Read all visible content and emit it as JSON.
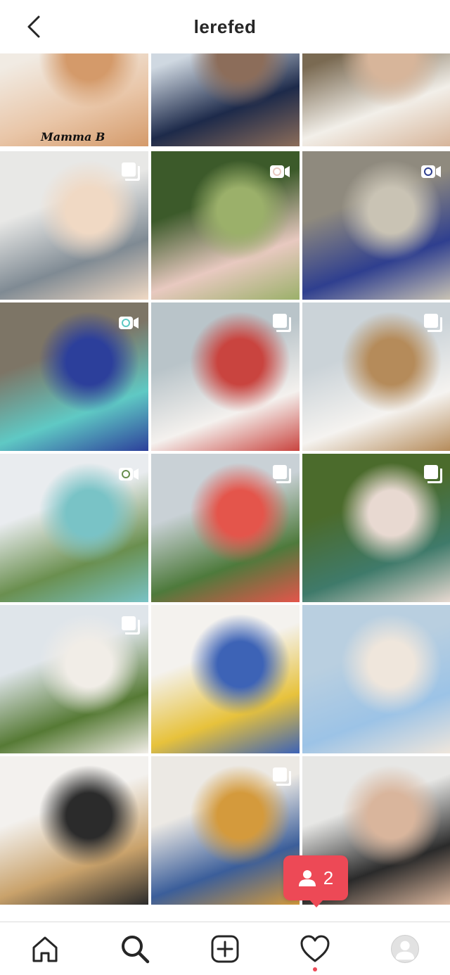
{
  "header": {
    "username": "lerefed",
    "back_icon": "chevron-left-icon"
  },
  "grid": {
    "tiles": [
      {
        "row": 0,
        "col": 0,
        "kind": "photo",
        "badge": null,
        "caption_overlay": "Mamma B",
        "palette": [
          "#f1ebe3",
          "#e9c6a8",
          "#d49a6a"
        ]
      },
      {
        "row": 0,
        "col": 1,
        "kind": "photo",
        "badge": null,
        "palette": [
          "#cfd8e1",
          "#1d2a4a",
          "#8c6d5a"
        ]
      },
      {
        "row": 0,
        "col": 2,
        "kind": "photo",
        "badge": null,
        "palette": [
          "#7a6a52",
          "#f2efe9",
          "#d7b59a"
        ]
      },
      {
        "row": 1,
        "col": 0,
        "kind": "photo",
        "badge": "carousel",
        "palette": [
          "#e8e8e6",
          "#7f8a93",
          "#f0d9c4"
        ]
      },
      {
        "row": 1,
        "col": 1,
        "kind": "video",
        "badge": "video",
        "palette": [
          "#3c5a2a",
          "#e8c9c0",
          "#9bb06a"
        ]
      },
      {
        "row": 1,
        "col": 2,
        "kind": "video",
        "badge": "video",
        "palette": [
          "#8f8a7e",
          "#2f3f8f",
          "#c9c3b4"
        ]
      },
      {
        "row": 2,
        "col": 0,
        "kind": "video",
        "badge": "video",
        "palette": [
          "#7d7566",
          "#5fc9c4",
          "#2c3f9b"
        ]
      },
      {
        "row": 2,
        "col": 1,
        "kind": "photo",
        "badge": "carousel",
        "palette": [
          "#b9c4c9",
          "#f4f1ee",
          "#c9443f"
        ]
      },
      {
        "row": 2,
        "col": 2,
        "kind": "photo",
        "badge": "carousel",
        "palette": [
          "#cbd3d8",
          "#f5f3f0",
          "#b58b5a"
        ]
      },
      {
        "row": 3,
        "col": 0,
        "kind": "video",
        "badge": "video",
        "palette": [
          "#e9ecef",
          "#6a8f4f",
          "#79c3c6"
        ]
      },
      {
        "row": 3,
        "col": 1,
        "kind": "photo",
        "badge": "carousel",
        "palette": [
          "#c9d1d6",
          "#4e7a3c",
          "#e4554b"
        ]
      },
      {
        "row": 3,
        "col": 2,
        "kind": "photo",
        "badge": "carousel",
        "palette": [
          "#4b6b2c",
          "#3f7a6a",
          "#e8d9d1"
        ]
      },
      {
        "row": 4,
        "col": 0,
        "kind": "photo",
        "badge": "carousel",
        "palette": [
          "#dfe5ea",
          "#567a35",
          "#f1ede7"
        ]
      },
      {
        "row": 4,
        "col": 1,
        "kind": "photo",
        "badge": null,
        "palette": [
          "#f4f2ee",
          "#e7c23c",
          "#3d63b6"
        ]
      },
      {
        "row": 4,
        "col": 2,
        "kind": "photo",
        "badge": null,
        "palette": [
          "#b9cfe0",
          "#9cc3e6",
          "#efe6dc"
        ]
      },
      {
        "row": 5,
        "col": 0,
        "kind": "photo",
        "badge": null,
        "palette": [
          "#f3f1ee",
          "#c9a26b",
          "#2b2b2b"
        ]
      },
      {
        "row": 5,
        "col": 1,
        "kind": "photo",
        "badge": "carousel",
        "palette": [
          "#ece9e4",
          "#3b5e9a",
          "#d49a3c"
        ]
      },
      {
        "row": 5,
        "col": 2,
        "kind": "photo",
        "badge": null,
        "palette": [
          "#e7e7e5",
          "#2a2a2a",
          "#d9b59c"
        ]
      }
    ]
  },
  "activity_popup": {
    "icon": "person-icon",
    "count": "2",
    "color": "#ed4956"
  },
  "tab_bar": {
    "items": [
      {
        "name": "home",
        "icon": "home-icon"
      },
      {
        "name": "search",
        "icon": "search-icon",
        "active": true
      },
      {
        "name": "new-post",
        "icon": "plus-square-icon"
      },
      {
        "name": "activity",
        "icon": "heart-icon",
        "has_notification_dot": true
      },
      {
        "name": "profile",
        "icon": "avatar-icon"
      }
    ]
  },
  "colors": {
    "text": "#262626",
    "border": "#dbdbdb",
    "notification": "#ed4956"
  }
}
